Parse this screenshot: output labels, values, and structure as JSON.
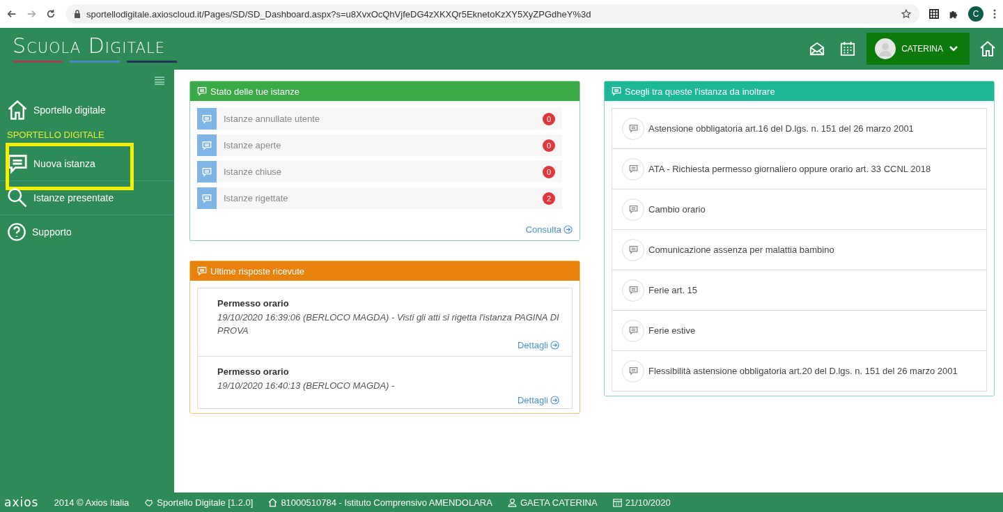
{
  "browser": {
    "url": "sportellodigitale.axioscloud.it/Pages/SD/SD_Dashboard.aspx?s=u8XvxOcQhVjfeDG4zXKXQr5EknetoKzXY5XyZPGdheY%3d",
    "profile": "C"
  },
  "header": {
    "logo": "Scuola Digitale",
    "user": "CATERINA"
  },
  "sidebar": {
    "items": [
      {
        "kind": "link",
        "label": "Sportello digitale",
        "highlighted": false
      },
      {
        "kind": "section",
        "label": "SPORTELLO DIGITALE"
      },
      {
        "kind": "link",
        "label": "Nuova istanza",
        "highlighted": true
      },
      {
        "kind": "link",
        "label": "Istanze presentate",
        "highlighted": false
      },
      {
        "kind": "link",
        "label": "Supporto",
        "highlighted": false
      }
    ]
  },
  "status_card": {
    "title": "Stato delle tue istanze",
    "rows": [
      {
        "label": "Istanze annullate utente",
        "count": "0"
      },
      {
        "label": "Istanze aperte",
        "count": "0"
      },
      {
        "label": "Istanze chiuse",
        "count": "0"
      },
      {
        "label": "Istanze rigettate",
        "count": "2"
      }
    ],
    "link": "Consulta"
  },
  "replies_card": {
    "title": "Ultime risposte ricevute",
    "items": [
      {
        "title": "Permesso orario",
        "text": "19/10/2020 16:39:06 (BERLOCO MAGDA) - Visti gli atti si rigetta l'istanza PAGINA DI PROVA",
        "link": "Dettagli"
      },
      {
        "title": "Permesso orario",
        "text": "19/10/2020 16:40:13 (BERLOCO MAGDA) -",
        "link": "Dettagli"
      }
    ]
  },
  "options_card": {
    "title": "Scegli tra queste l'istanza da inoltrare",
    "items": [
      "Astensione obbligatoria art.16 del D.lgs. n. 151 del 26 marzo 2001",
      "ATA - Richiesta permesso giornaliero oppure orario art. 33 CCNL 2018",
      "Cambio orario",
      "Comunicazione assenza per malattia bambino",
      "Ferie art. 15",
      "Ferie estive",
      "Flessibilità astensione obbligatoria art.20 del D.lgs. n. 151 del 26 marzo 2001"
    ]
  },
  "footer": {
    "logo": "axios",
    "items": [
      "2014 © Axios Italia",
      "Sportello Digitale [1.2.0]",
      "81000510784 - Istituto Comprensivo AMENDOLARA",
      "GAETA CATERINA",
      "21/10/2020"
    ]
  }
}
